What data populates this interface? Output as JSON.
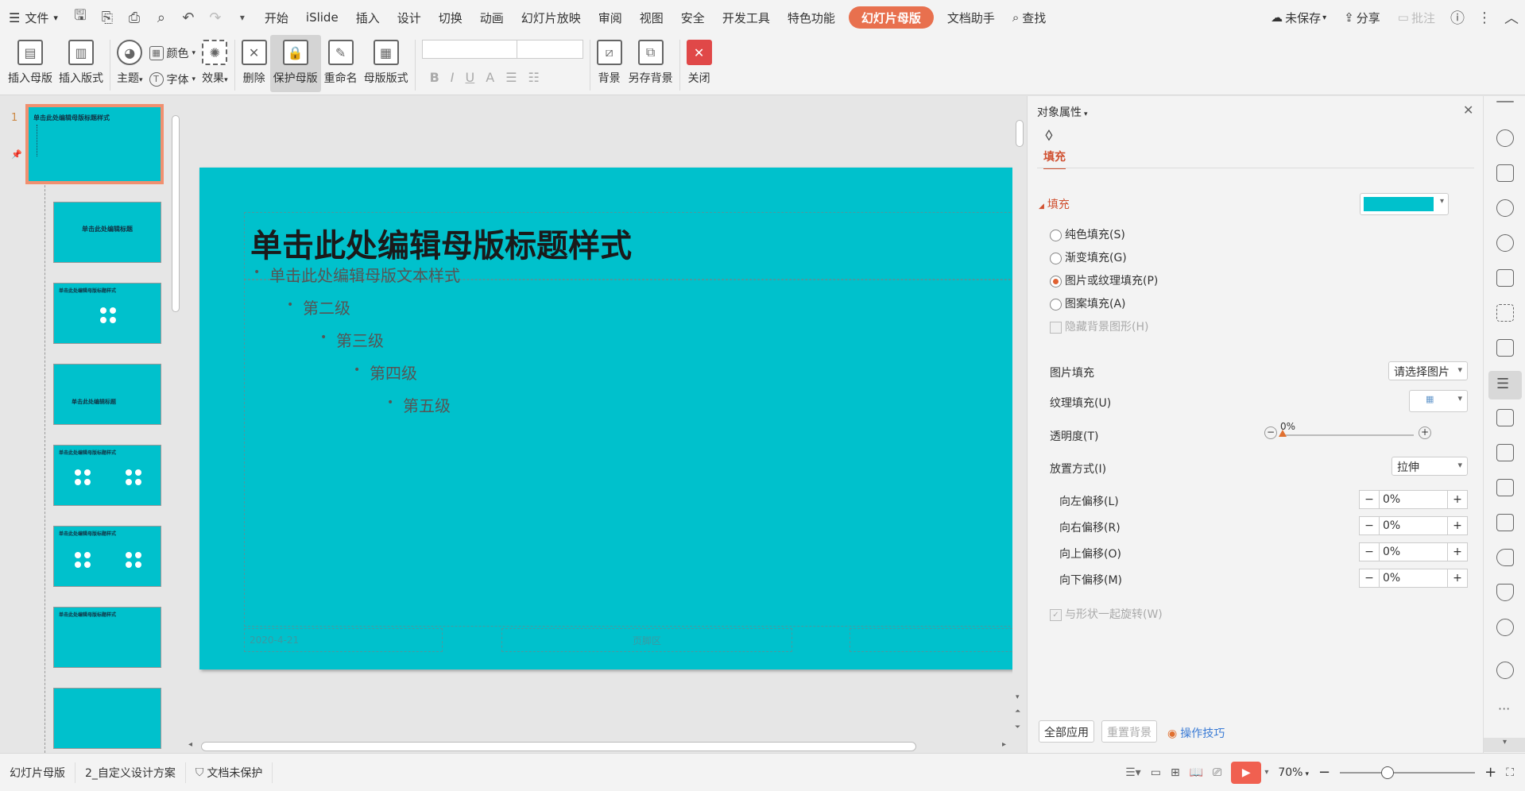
{
  "menubar": {
    "file": "文件",
    "tabs": [
      "开始",
      "iSlide",
      "插入",
      "设计",
      "切换",
      "动画",
      "幻灯片放映",
      "审阅",
      "视图",
      "安全",
      "开发工具",
      "特色功能"
    ],
    "active_tab": "幻灯片母版",
    "doc_helper": "文档助手",
    "search": "查找",
    "unsaved": "未保存",
    "share": "分享",
    "comment": "批注"
  },
  "ribbon": {
    "insert_master": "插入母版",
    "insert_layout": "插入版式",
    "theme": "主题",
    "color": "颜色",
    "font": "字体",
    "effect": "效果",
    "delete": "删除",
    "protect_master": "保护母版",
    "rename": "重命名",
    "master_layout": "母版版式",
    "background": "背景",
    "save_background": "另存背景",
    "close": "关闭"
  },
  "thumbnails": {
    "slide_number": "1",
    "master_title": "单击此处编辑母版标题样式",
    "layout_title": "单击此处编辑标题",
    "section_title": "单击此处编辑标题"
  },
  "slide": {
    "title": "单击此处编辑母版标题样式",
    "levels": [
      "单击此处编辑母版文本样式",
      "第二级",
      "第三级",
      "第四级",
      "第五级"
    ],
    "date": "2020-4-21",
    "footer": "页脚区"
  },
  "props": {
    "header": "对象属性",
    "tab_fill": "填充",
    "section_fill": "填充",
    "fill_color": "#00c1cc",
    "options": [
      "纯色填充(S)",
      "渐变填充(G)",
      "图片或纹理填充(P)",
      "图案填充(A)"
    ],
    "hide_bg": "隐藏背景图形(H)",
    "picture_fill_label": "图片填充",
    "picture_fill_value": "请选择图片",
    "texture_fill_label": "纹理填充(U)",
    "transparency_label": "透明度(T)",
    "transparency_value": "0%",
    "placement_label": "放置方式(I)",
    "placement_value": "拉伸",
    "offsets": [
      {
        "label": "向左偏移(L)",
        "value": "0%"
      },
      {
        "label": "向右偏移(R)",
        "value": "0%"
      },
      {
        "label": "向上偏移(O)",
        "value": "0%"
      },
      {
        "label": "向下偏移(M)",
        "value": "0%"
      }
    ],
    "rotate_with_shape": "与形状一起旋转(W)",
    "apply_all": "全部应用",
    "reset_bg": "重置背景",
    "tips": "操作技巧"
  },
  "status": {
    "mode": "幻灯片母版",
    "design": "2_自定义设计方案",
    "protect": "文档未保护",
    "zoom": "70%"
  }
}
